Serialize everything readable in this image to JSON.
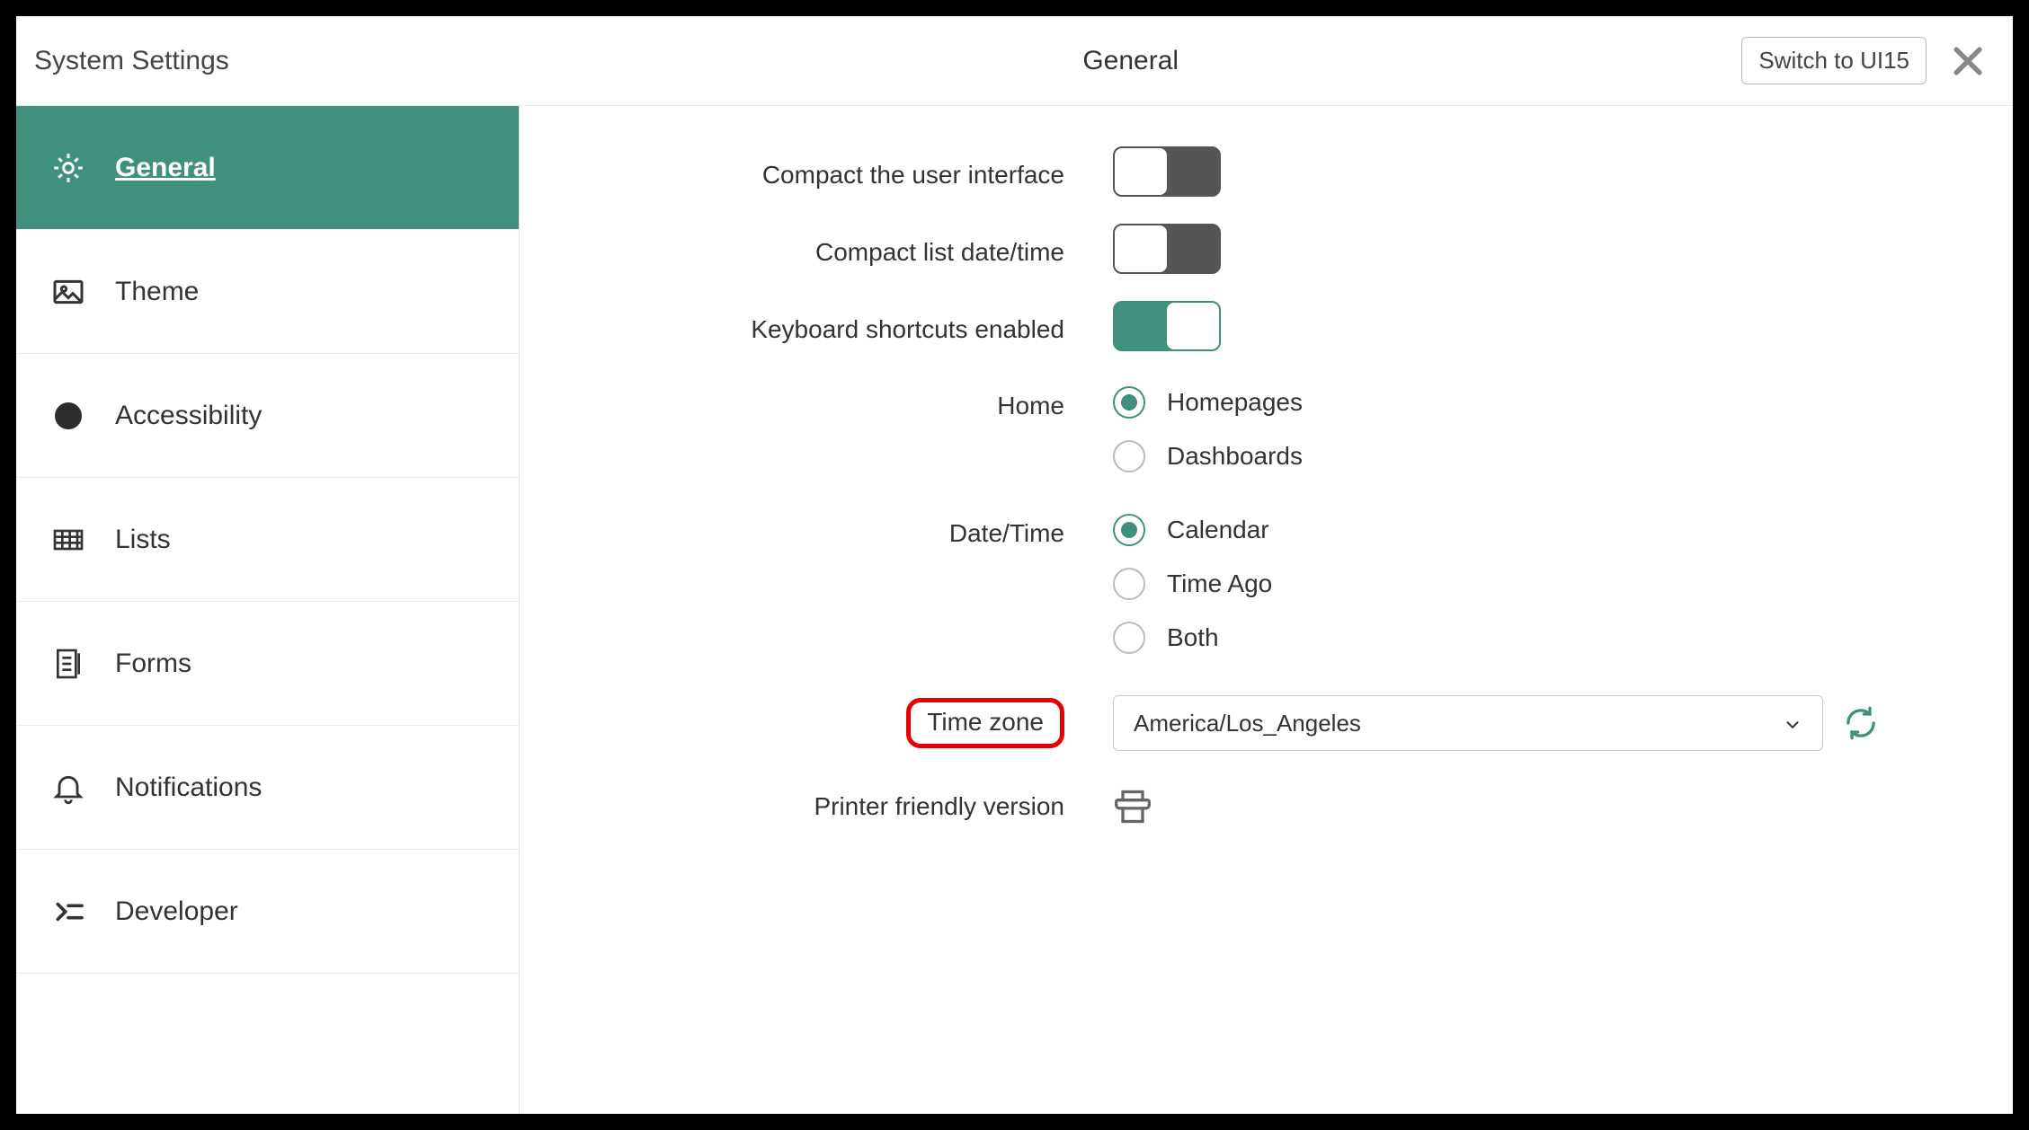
{
  "header": {
    "left_title": "System Settings",
    "center_title": "General",
    "switch_button": "Switch to UI15"
  },
  "sidebar": {
    "items": [
      {
        "id": "general",
        "label": "General",
        "active": true
      },
      {
        "id": "theme",
        "label": "Theme",
        "active": false
      },
      {
        "id": "accessibility",
        "label": "Accessibility",
        "active": false
      },
      {
        "id": "lists",
        "label": "Lists",
        "active": false
      },
      {
        "id": "forms",
        "label": "Forms",
        "active": false
      },
      {
        "id": "notifications",
        "label": "Notifications",
        "active": false
      },
      {
        "id": "developer",
        "label": "Developer",
        "active": false
      }
    ]
  },
  "settings": {
    "compact_ui": {
      "label": "Compact the user interface",
      "value": false
    },
    "compact_date": {
      "label": "Compact list date/time",
      "value": false
    },
    "kbd_shortcuts": {
      "label": "Keyboard shortcuts enabled",
      "value": true
    },
    "home": {
      "label": "Home",
      "options": [
        "Homepages",
        "Dashboards"
      ],
      "selected": "Homepages"
    },
    "datetime": {
      "label": "Date/Time",
      "options": [
        "Calendar",
        "Time Ago",
        "Both"
      ],
      "selected": "Calendar"
    },
    "timezone": {
      "label": "Time zone",
      "value": "America/Los_Angeles",
      "highlighted": true
    },
    "printer": {
      "label": "Printer friendly version"
    }
  }
}
